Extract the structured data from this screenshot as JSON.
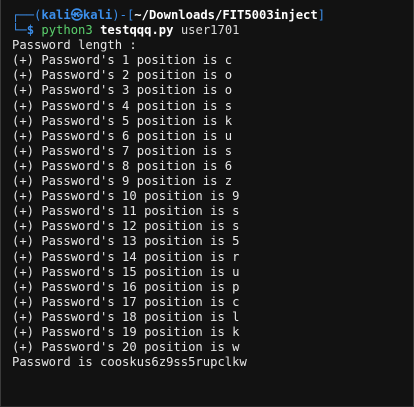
{
  "prompt": {
    "user": "kali",
    "at_symbol": "㉿",
    "host": "kali",
    "cwd": "~/Downloads/FIT5003inject",
    "top_prefix": "┌──(",
    "mid": ")-[",
    "top_suffix": "]",
    "bottom_prefix": "└─",
    "dollar": "$"
  },
  "command": {
    "program": "python3",
    "script": "testqqq.py",
    "arg": "user1701"
  },
  "output": {
    "header": "Password length :",
    "lines": [
      "(+) Password's 1 position is c",
      "(+) Password's 2 position is o",
      "(+) Password's 3 position is o",
      "(+) Password's 4 position is s",
      "(+) Password's 5 position is k",
      "(+) Password's 6 position is u",
      "(+) Password's 7 position is s",
      "(+) Password's 8 position is 6",
      "(+) Password's 9 position is z",
      "(+) Password's 10 position is 9",
      "(+) Password's 11 position is s",
      "(+) Password's 12 position is s",
      "(+) Password's 13 position is 5",
      "(+) Password's 14 position is r",
      "(+) Password's 15 position is u",
      "(+) Password's 16 position is p",
      "(+) Password's 17 position is c",
      "(+) Password's 18 position is l",
      "(+) Password's 19 position is k",
      "(+) Password's 20 position is w"
    ],
    "result": "Password is cooskus6z9ss5rupclkw"
  },
  "colors": {
    "background": "#121212",
    "prompt_blue": "#3b8eea",
    "command_green": "#5bd16d",
    "text": "#e6e6e6"
  }
}
